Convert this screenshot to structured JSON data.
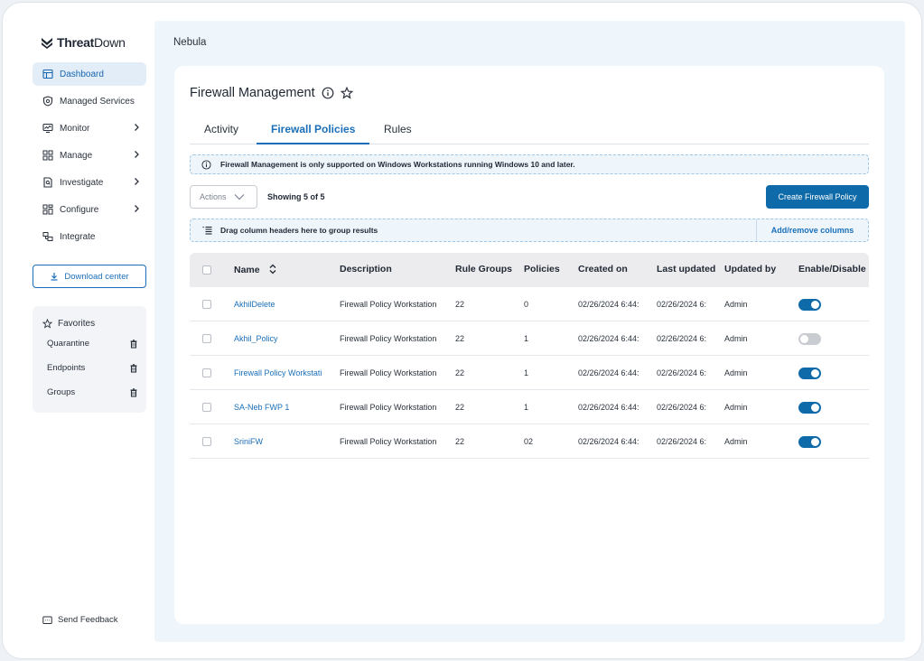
{
  "app": {
    "logo_bold": "Threat",
    "logo_light": "Down",
    "breadcrumb": "Nebula"
  },
  "sidebar": {
    "items": [
      {
        "label": "Dashboard",
        "icon": "dashboard-icon",
        "active": true
      },
      {
        "label": "Managed Services",
        "icon": "shield-icon"
      },
      {
        "label": "Monitor",
        "icon": "monitor-icon",
        "chevron": true
      },
      {
        "label": "Manage",
        "icon": "grid-icon",
        "chevron": true
      },
      {
        "label": "Investigate",
        "icon": "document-search-icon",
        "chevron": true
      },
      {
        "label": "Configure",
        "icon": "configure-icon",
        "chevron": true
      },
      {
        "label": "Integrate",
        "icon": "integrate-icon"
      }
    ],
    "download_label": "Download center",
    "favorites_title": "Favorites",
    "favorites": [
      {
        "label": "Quarantine"
      },
      {
        "label": "Endpoints"
      },
      {
        "label": "Groups"
      }
    ],
    "feedback_label": "Send Feedback"
  },
  "page": {
    "title": "Firewall Management",
    "tabs": [
      "Activity",
      "Firewall Policies",
      "Rules"
    ],
    "active_tab": "Firewall Policies",
    "banner": "Firewall Management is only supported on Windows Workstations running Windows 10 and later.",
    "actions_label": "Actions",
    "showing": "Showing 5 of 5",
    "create_label": "Create Firewall Policy",
    "group_hint": "Drag column headers here to group results",
    "add_remove_columns": "Add/remove columns"
  },
  "table": {
    "columns": [
      "Name",
      "Description",
      "Rule Groups",
      "Policies",
      "Created on",
      "Last updated",
      "Updated by",
      "Enable/Disable"
    ],
    "rows": [
      {
        "name": "AkhilDelete",
        "description": "Firewall Policy Workstation",
        "rule_groups": "22",
        "policies": "0",
        "created": "02/26/2024 6:44:",
        "updated": "02/26/2024 6:",
        "updated_by": "Admin",
        "enabled": true
      },
      {
        "name": "Akhil_Policy",
        "description": "Firewall Policy Workstation",
        "rule_groups": "22",
        "policies": "1",
        "created": "02/26/2024 6:44:",
        "updated": "02/26/2024 6:",
        "updated_by": "Admin",
        "enabled": false
      },
      {
        "name": "Firewall Policy Workstati",
        "description": "Firewall Policy Workstation",
        "rule_groups": "22",
        "policies": "1",
        "created": "02/26/2024 6:44:",
        "updated": "02/26/2024 6:",
        "updated_by": "Admin",
        "enabled": true
      },
      {
        "name": "SA-Neb FWP 1",
        "description": "Firewall Policy Workstation",
        "rule_groups": "22",
        "policies": "1",
        "created": "02/26/2024 6:44:",
        "updated": "02/26/2024 6:",
        "updated_by": "Admin",
        "enabled": true
      },
      {
        "name": "SriniFW",
        "description": "Firewall Policy Workstation",
        "rule_groups": "22",
        "policies": "02",
        "created": "02/26/2024 6:44:",
        "updated": "02/26/2024 6:",
        "updated_by": "Admin",
        "enabled": true
      }
    ]
  },
  "colors": {
    "accent": "#1b6fb8",
    "primary_button": "#0f6aa9",
    "active_nav_bg": "#e3edf8"
  }
}
